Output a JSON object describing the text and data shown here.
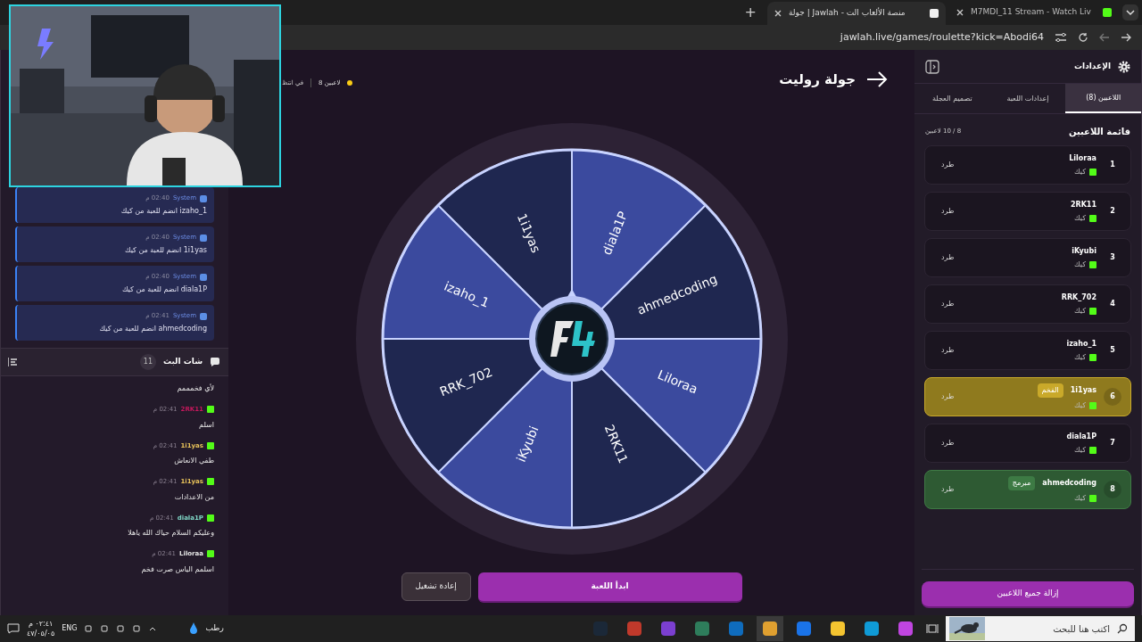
{
  "browser": {
    "tabs": [
      {
        "title": "M7MDI_11 Stream - Watch Liv",
        "selected": false
      },
      {
        "title": "جولة | Jawlah - منصة الألعاب الت",
        "selected": true
      }
    ],
    "new_tab": "+",
    "url": "jawlah.live/games/roulette?kick=Abodi64"
  },
  "system_messages": [
    {
      "sender": "System",
      "time": "02:40 م",
      "text": "izaho_1 انضم للعبة من كيك"
    },
    {
      "sender": "System",
      "time": "02:40 م",
      "text": "1i1yas انضم للعبة من كيك"
    },
    {
      "sender": "System",
      "time": "02:40 م",
      "text": "diala1P انضم للعبة من كيك"
    },
    {
      "sender": "System",
      "time": "02:41 م",
      "text": "ahmedcoding انضم للعبة من كيك"
    }
  ],
  "chat": {
    "title": "شات البث",
    "count": "11",
    "first_text": "لأي فخمممم",
    "messages": [
      {
        "user": "2RK11",
        "color": "#c2185b",
        "time": "02:41 م",
        "text": "اسلم"
      },
      {
        "user": "1i1yas",
        "color": "#e8c25a",
        "time": "02:41 م",
        "text": "طفي الانعاش"
      },
      {
        "user": "1i1yas",
        "color": "#e8c25a",
        "time": "02:41 م",
        "text": "من الاعدادات"
      },
      {
        "user": "diala1P",
        "color": "#7fd6c6",
        "time": "02:41 م",
        "text": "وعليكم السلام حياك الله ياهلا"
      },
      {
        "user": "Liloraa",
        "color": "#e5e5e5",
        "time": "02:41 م",
        "text": "اسلمم الياس صرت فخم"
      }
    ]
  },
  "game": {
    "title": "جولة روليت",
    "players": "8 لاعبين",
    "status": "في انتظ",
    "segments": [
      {
        "label": "diala1P",
        "color": "#3b4a9e"
      },
      {
        "label": "ahmedcoding",
        "color": "#1f2750"
      },
      {
        "label": "Liloraa",
        "color": "#3b4a9e"
      },
      {
        "label": "2RK11",
        "color": "#1f2750"
      },
      {
        "label": "iKyubi",
        "color": "#3b4a9e"
      },
      {
        "label": "RRK_702",
        "color": "#1f2750"
      },
      {
        "label": "izaho_1",
        "color": "#3b4a9e"
      },
      {
        "label": "1i1yas",
        "color": "#1f2750"
      }
    ],
    "restart": "إعادة تشغيل",
    "start": "ابدأ اللعبة"
  },
  "settings": {
    "title": "الإعدادات",
    "tabs": [
      {
        "label": "اللاعبين (8)",
        "selected": true
      },
      {
        "label": "إعدادات اللعبة",
        "selected": false
      },
      {
        "label": "تصميم العجلة",
        "selected": false
      }
    ],
    "list_title": "قائمة اللاعبين",
    "capacity": "8 / 10 لاعبين",
    "players": [
      {
        "number": "1",
        "name": "Liloraa",
        "platform": "كيك",
        "kind": "plain",
        "action": "طرد"
      },
      {
        "number": "2",
        "name": "2RK11",
        "platform": "كيك",
        "kind": "plain",
        "action": "طرد"
      },
      {
        "number": "3",
        "name": "iKyubi",
        "platform": "كيك",
        "kind": "plain",
        "action": "طرد"
      },
      {
        "number": "4",
        "name": "RRK_702",
        "platform": "كيك",
        "kind": "plain",
        "action": "طرد"
      },
      {
        "number": "5",
        "name": "izaho_1",
        "platform": "كيك",
        "kind": "plain",
        "action": "طرد"
      },
      {
        "number": "6",
        "name": "1i1yas",
        "platform": "كيك",
        "kind": "gold",
        "badge": "الفخم",
        "action": "طرد"
      },
      {
        "number": "7",
        "name": "diala1P",
        "platform": "كيك",
        "kind": "plain",
        "action": "طرد"
      },
      {
        "number": "8",
        "name": "ahmedcoding",
        "platform": "كيك",
        "kind": "green",
        "badge": "مبرمج",
        "action": "طرد"
      }
    ],
    "remove_all": "إزالة جميع اللاعبين"
  },
  "taskbar": {
    "search_placeholder": "اكتب هنا للبحث",
    "weather": "رطب",
    "language": "ENG",
    "time": "٠٢:٤١ م",
    "date": "٤٧/٠٥/٠٥"
  }
}
